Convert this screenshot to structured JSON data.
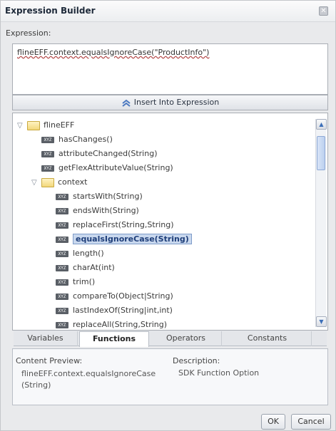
{
  "window": {
    "title": "Expression Builder",
    "close_icon": "close-icon"
  },
  "expression": {
    "label": "Expression:",
    "value": "flineEFF.context.equalsIgnoreCase(\"ProductInfo\")"
  },
  "insert_button": {
    "label": "Insert Into Expression",
    "icon": "double-chevron-up-icon"
  },
  "tree": {
    "root": {
      "label": "flineEFF",
      "expanded": true
    },
    "root_items": [
      "hasChanges()",
      "attributeChanged(String)",
      "getFlexAttributeValue(String)"
    ],
    "context": {
      "label": "context",
      "expanded": true
    },
    "context_items": [
      "startsWith(String)",
      "endsWith(String)",
      "replaceFirst(String,String)",
      "equalsIgnoreCase(String)",
      "length()",
      "charAt(int)",
      "trim()",
      "compareTo(Object|String)",
      "lastIndexOf(String|int,int)",
      "replaceAll(String,String)"
    ],
    "selected_item": "equalsIgnoreCase(String)",
    "function_badge": "XYZ"
  },
  "tabs": [
    "Variables",
    "Functions",
    "Operators",
    "Constants"
  ],
  "active_tab": "Functions",
  "preview": {
    "content_label": "Content Preview:",
    "content_line1": "flineEFF.context.equalsIgnoreCase",
    "content_line2": "(String)",
    "description_label": "Description:",
    "description_value": "SDK Function Option"
  },
  "buttons": {
    "ok": "OK",
    "cancel": "Cancel"
  },
  "colors": {
    "selection_bg": "#c9d8ee",
    "selection_text": "#1f3f7a",
    "folder": "#f2d77a"
  }
}
